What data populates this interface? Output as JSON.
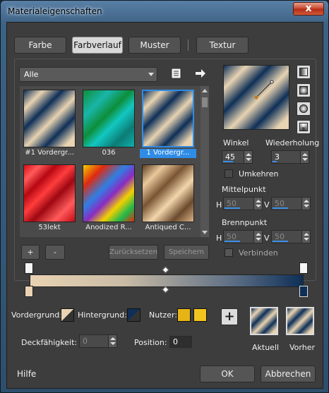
{
  "window": {
    "title": "Materialeigenschaften",
    "close_glyph": "x"
  },
  "tabs": [
    {
      "label": "Farbe"
    },
    {
      "label": "Farbverlauf"
    },
    {
      "label": "Muster"
    },
    {
      "label": "Textur"
    }
  ],
  "category_dropdown": {
    "value": "Alle"
  },
  "thumbnails": [
    {
      "label": "#1 Vordergr...",
      "style": "grad-a"
    },
    {
      "label": "036",
      "style": "grad-b"
    },
    {
      "label": "1 Vordergr...",
      "style": "grad-a",
      "selected": true
    },
    {
      "label": "53lekt",
      "style": "grad-c"
    },
    {
      "label": "Anodized R...",
      "style": "grad-d"
    },
    {
      "label": "Antiqued C...",
      "style": "grad-e"
    }
  ],
  "angle": {
    "label": "Winkel",
    "value": "45"
  },
  "repeat": {
    "label": "Wiederholung",
    "value": "3"
  },
  "invert": {
    "label": "Umkehren"
  },
  "center": {
    "label": "Mittelpunkt",
    "h_label": "H",
    "h_value": "50",
    "v_label": "V",
    "v_value": "50"
  },
  "focus": {
    "label": "Brennpunkt",
    "h_label": "H",
    "h_value": "50",
    "v_label": "V",
    "v_value": "50"
  },
  "link": {
    "label": "Verbinden"
  },
  "grid_buttons": {
    "add": "+",
    "remove": "-",
    "reset": "Zurücksetzen",
    "save": "Speichern"
  },
  "colors": {
    "foreground_label": "Vordergrund:",
    "background_label": "Hintergrund:",
    "user_label": "Nutzer:",
    "user_color_1": "#e6b414",
    "user_color_2": "#f2c420"
  },
  "opacity": {
    "label": "Deckfähigkeit:",
    "value": "0"
  },
  "position": {
    "label": "Position:",
    "value": "0"
  },
  "add_swatch": "+",
  "current": {
    "label": "Aktuell"
  },
  "previous": {
    "label": "Vorher"
  },
  "footer": {
    "help": "Hilfe",
    "ok": "OK",
    "cancel": "Abbrechen"
  }
}
